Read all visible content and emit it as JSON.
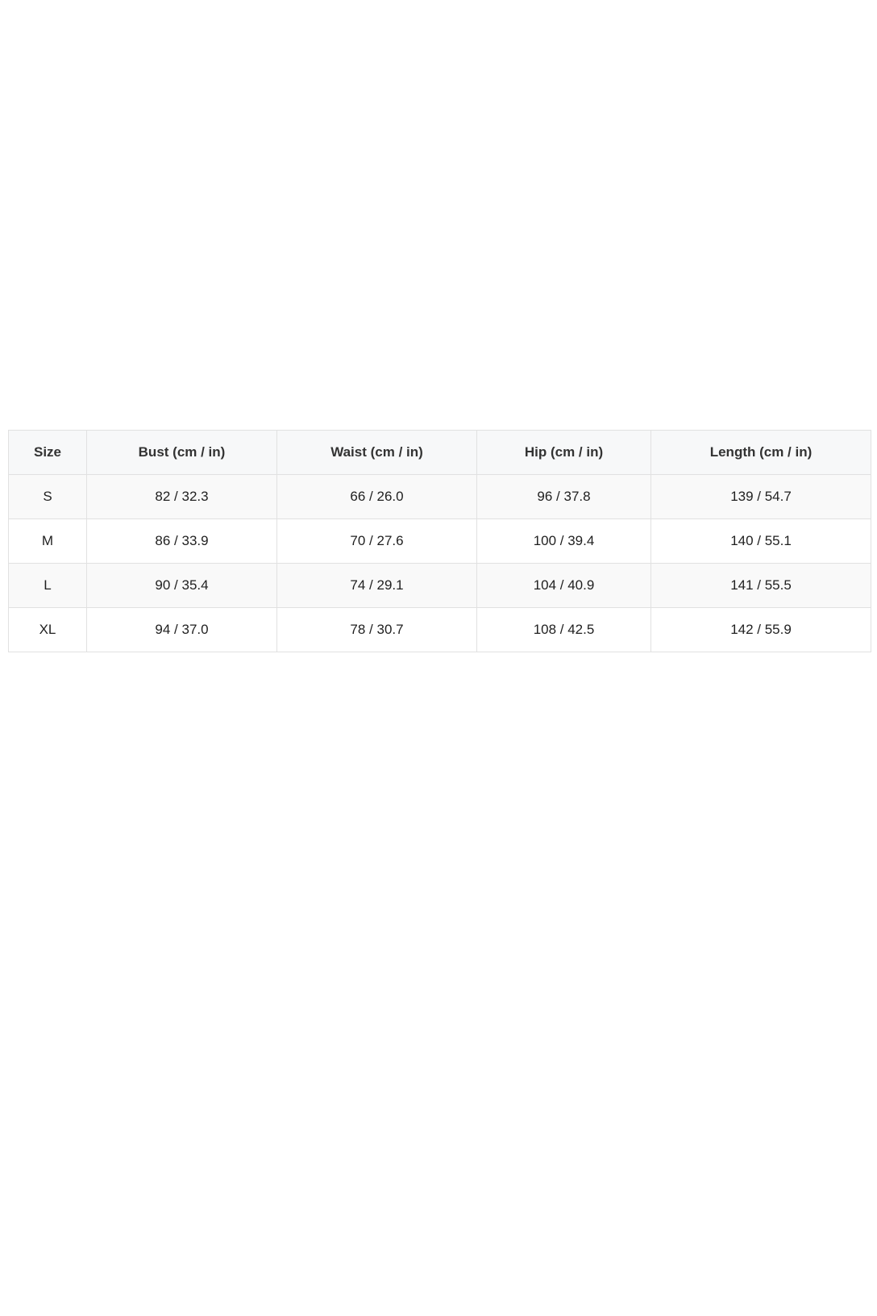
{
  "size_chart": {
    "headers": [
      "Size",
      "Bust (cm / in)",
      "Waist (cm / in)",
      "Hip (cm / in)",
      "Length (cm / in)"
    ],
    "rows": [
      [
        "S",
        "82 / 32.3",
        "66 / 26.0",
        "96 / 37.8",
        "139 / 54.7"
      ],
      [
        "M",
        "86 / 33.9",
        "70 / 27.6",
        "100 / 39.4",
        "140 / 55.1"
      ],
      [
        "L",
        "90 / 35.4",
        "74 / 29.1",
        "104 / 40.9",
        "141 / 55.5"
      ],
      [
        "XL",
        "94 / 37.0",
        "78 / 30.7",
        "108 / 42.5",
        "142 / 55.9"
      ]
    ]
  }
}
